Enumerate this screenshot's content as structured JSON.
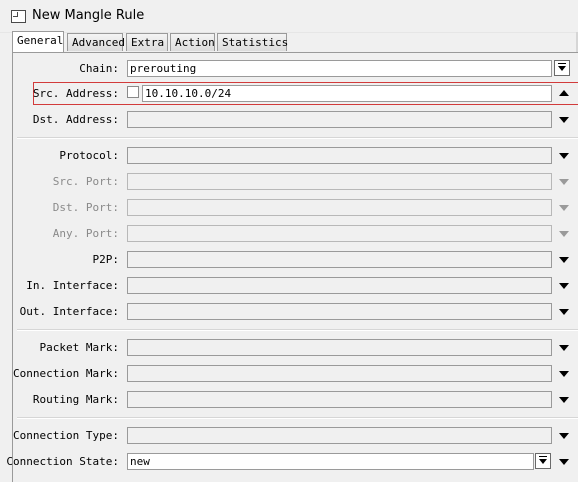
{
  "window": {
    "title": "New Mangle Rule",
    "icon": "window-icon"
  },
  "tabs": [
    {
      "label": "General",
      "active": true
    },
    {
      "label": "Advanced",
      "active": false
    },
    {
      "label": "Extra",
      "active": false
    },
    {
      "label": "Action",
      "active": false
    },
    {
      "label": "Statistics",
      "active": false
    }
  ],
  "fields": {
    "chain": {
      "label": "Chain:",
      "value": "prerouting"
    },
    "src_address": {
      "label": "Src. Address:",
      "value": "10.10.10.0/24",
      "negate": false
    },
    "dst_address": {
      "label": "Dst. Address:",
      "value": ""
    },
    "protocol": {
      "label": "Protocol:",
      "value": ""
    },
    "src_port": {
      "label": "Src. Port:",
      "value": ""
    },
    "dst_port": {
      "label": "Dst. Port:",
      "value": ""
    },
    "any_port": {
      "label": "Any. Port:",
      "value": ""
    },
    "p2p": {
      "label": "P2P:",
      "value": ""
    },
    "in_interface": {
      "label": "In. Interface:",
      "value": ""
    },
    "out_interface": {
      "label": "Out. Interface:",
      "value": ""
    },
    "packet_mark": {
      "label": "Packet Mark:",
      "value": ""
    },
    "connection_mark": {
      "label": "Connection Mark:",
      "value": ""
    },
    "routing_mark": {
      "label": "Routing Mark:",
      "value": ""
    },
    "connection_type": {
      "label": "Connection Type:",
      "value": ""
    },
    "connection_state": {
      "label": "Connection State:",
      "value": "new"
    }
  },
  "colors": {
    "highlight": "#d23b3b",
    "background": "#f0f0f0"
  }
}
